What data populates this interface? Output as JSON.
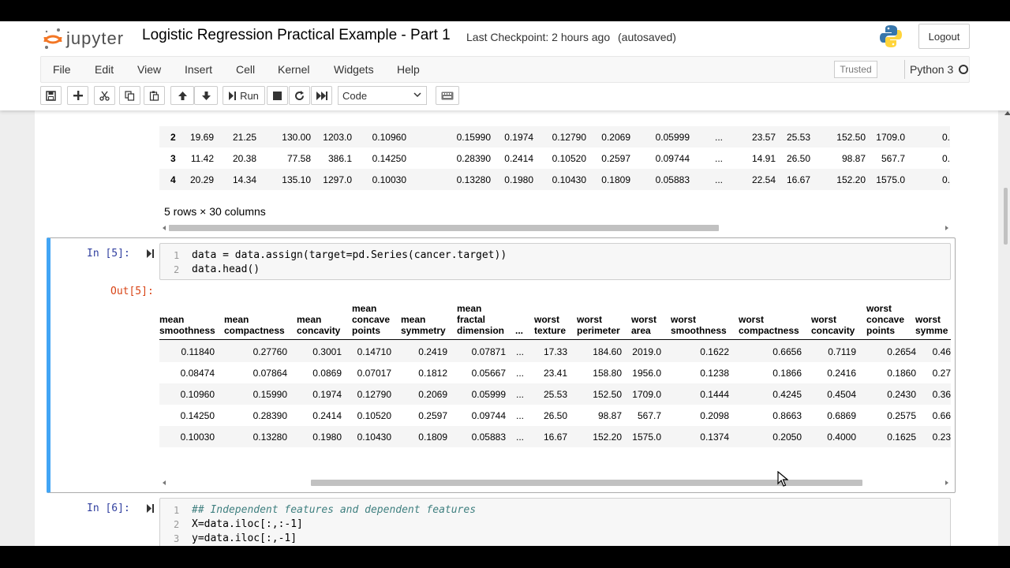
{
  "header": {
    "logo_text": "jupyter",
    "notebook_title": "Logistic Regression Practical Example - Part 1",
    "checkpoint_label": "Last Checkpoint: 2 hours ago",
    "autosave": "(autosaved)",
    "logout_label": "Logout"
  },
  "menubar": {
    "items": [
      "File",
      "Edit",
      "View",
      "Insert",
      "Cell",
      "Kernel",
      "Widgets",
      "Help"
    ],
    "trusted_label": "Trusted",
    "kernel_name": "Python 3"
  },
  "toolbar": {
    "run_label": "Run",
    "cell_type": "Code"
  },
  "top_output": {
    "rows": [
      {
        "idx": "2",
        "cols": [
          "19.69",
          "21.25",
          "130.00",
          "1203.0",
          "0.10960",
          "0.15990",
          "0.1974",
          "0.12790",
          "0.2069",
          "0.05999",
          "...",
          "23.57",
          "25.53",
          "152.50",
          "1709.0",
          "0."
        ]
      },
      {
        "idx": "3",
        "cols": [
          "11.42",
          "20.38",
          "77.58",
          "386.1",
          "0.14250",
          "0.28390",
          "0.2414",
          "0.10520",
          "0.2597",
          "0.09744",
          "...",
          "14.91",
          "26.50",
          "98.87",
          "567.7",
          "0."
        ]
      },
      {
        "idx": "4",
        "cols": [
          "20.29",
          "14.34",
          "135.10",
          "1297.0",
          "0.10030",
          "0.13280",
          "0.1980",
          "0.10430",
          "0.1809",
          "0.05883",
          "...",
          "22.54",
          "16.67",
          "152.20",
          "1575.0",
          "0."
        ]
      }
    ],
    "shape_info": "5 rows × 30 columns"
  },
  "cell5": {
    "in_prompt": "In [5]:",
    "out_prompt": "Out[5]:",
    "lines": [
      {
        "no": "1",
        "code": "data = data.assign(target=pd.Series(cancer.target))"
      },
      {
        "no": "2",
        "code": "data.head()"
      }
    ],
    "headers": [
      "mean\nsmoothness",
      "mean\ncompactness",
      "mean\nconcavity",
      "mean\nconcave\npoints",
      "mean\nsymmetry",
      "mean\nfractal\ndimension",
      "...",
      "worst\ntexture",
      "worst\nperimeter",
      "worst\narea",
      "worst\nsmoothness",
      "worst\ncompactness",
      "worst\nconcavity",
      "worst\nconcave\npoints",
      "worst\nsymme"
    ],
    "rows": [
      [
        "0.11840",
        "0.27760",
        "0.3001",
        "0.14710",
        "0.2419",
        "0.07871",
        "...",
        "17.33",
        "184.60",
        "2019.0",
        "0.1622",
        "0.6656",
        "0.7119",
        "0.2654",
        "0.46"
      ],
      [
        "0.08474",
        "0.07864",
        "0.0869",
        "0.07017",
        "0.1812",
        "0.05667",
        "...",
        "23.41",
        "158.80",
        "1956.0",
        "0.1238",
        "0.1866",
        "0.2416",
        "0.1860",
        "0.27"
      ],
      [
        "0.10960",
        "0.15990",
        "0.1974",
        "0.12790",
        "0.2069",
        "0.05999",
        "...",
        "25.53",
        "152.50",
        "1709.0",
        "0.1444",
        "0.4245",
        "0.4504",
        "0.2430",
        "0.36"
      ],
      [
        "0.14250",
        "0.28390",
        "0.2414",
        "0.10520",
        "0.2597",
        "0.09744",
        "...",
        "26.50",
        "98.87",
        "567.7",
        "0.2098",
        "0.8663",
        "0.6869",
        "0.2575",
        "0.66"
      ],
      [
        "0.10030",
        "0.13280",
        "0.1980",
        "0.10430",
        "0.1809",
        "0.05883",
        "...",
        "16.67",
        "152.20",
        "1575.0",
        "0.1374",
        "0.2050",
        "0.4000",
        "0.1625",
        "0.23"
      ]
    ]
  },
  "cell6": {
    "in_prompt": "In [6]:",
    "lines": [
      {
        "no": "1",
        "code": "## Independent features and dependent features"
      },
      {
        "no": "2",
        "code": "X=data.iloc[:,:-1]"
      },
      {
        "no": "3",
        "code": "y=data.iloc[:,-1]"
      }
    ]
  },
  "colors": {
    "accent_blue": "#42a5f5",
    "in_prompt": "#303f9f",
    "out_prompt": "#d84315",
    "jupyter_orange": "#f37726"
  },
  "icons": [
    "save-icon",
    "plus-icon",
    "scissors-icon",
    "copy-icon",
    "paste-icon",
    "arrow-up-icon",
    "arrow-down-icon",
    "run-icon",
    "stop-icon",
    "restart-icon",
    "fast-forward-icon",
    "keyboard-icon",
    "python-logo-icon",
    "mouse-cursor-icon"
  ]
}
